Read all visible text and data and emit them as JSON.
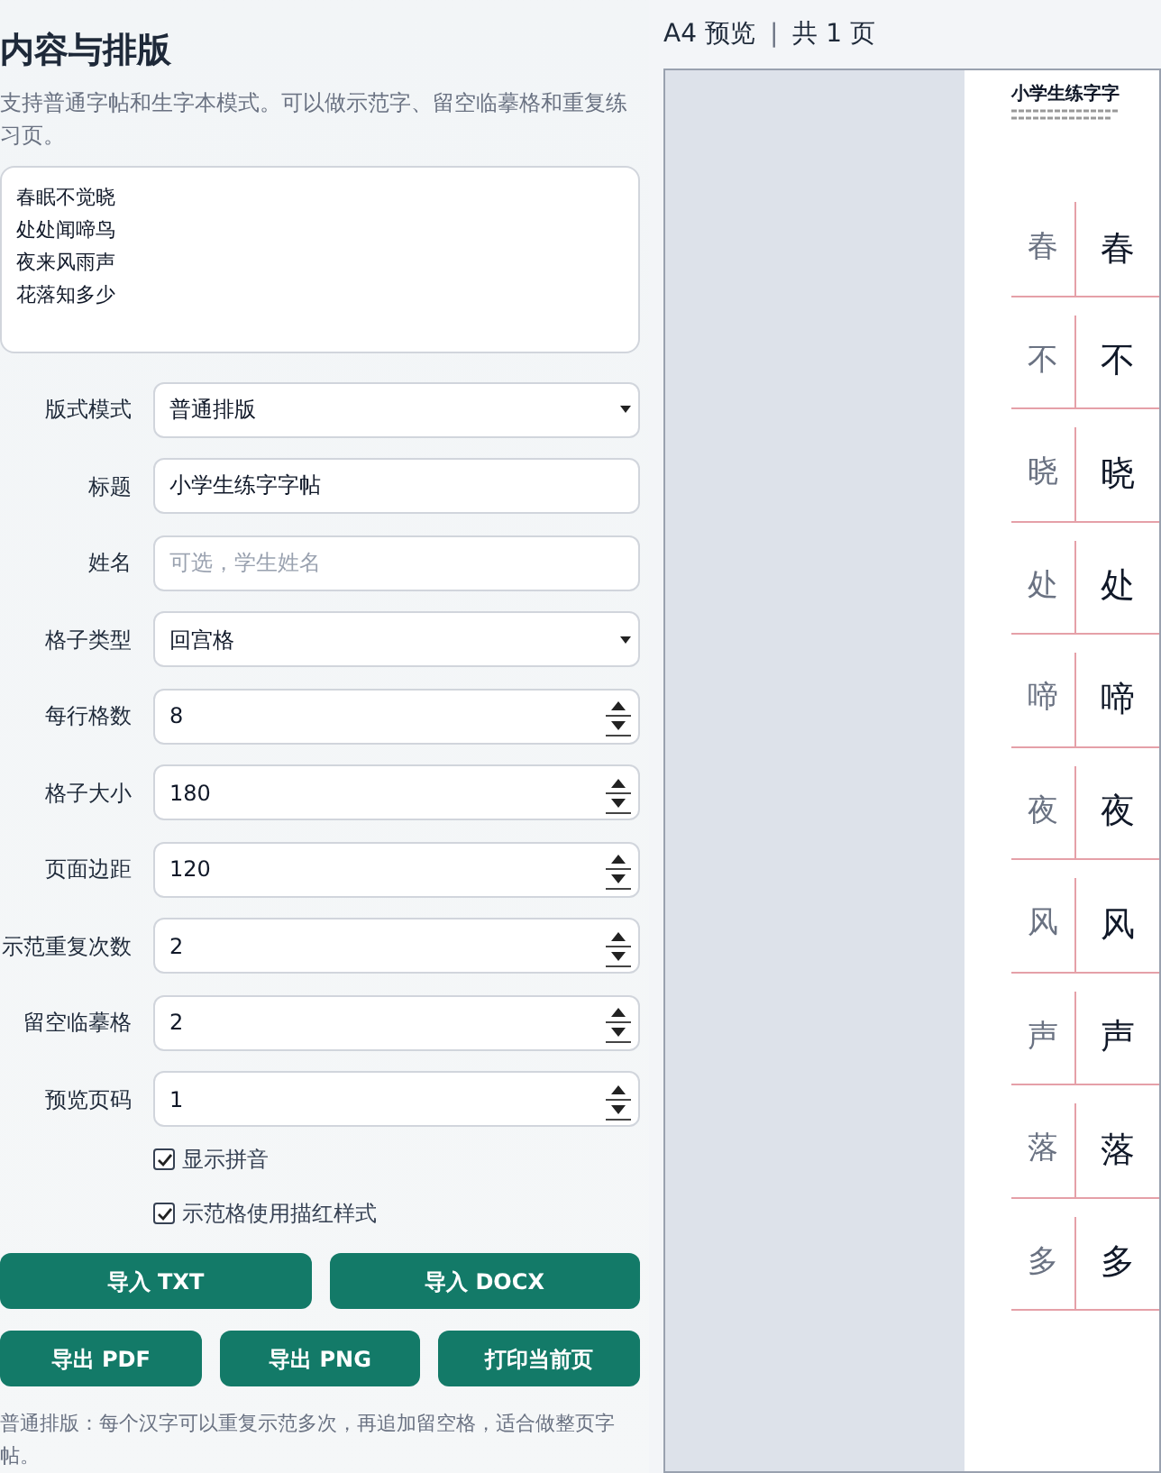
{
  "panel": {
    "title": "内容与排版",
    "description": "支持普通字帖和生字本模式。可以做示范字、留空临摹格和重复练习页。",
    "content_lines": [
      "春眠不觉晓",
      "处处闻啼鸟",
      "夜来风雨声",
      "花落知多少"
    ]
  },
  "fields": [
    {
      "kind": "select",
      "label": "版式模式",
      "value": "普通排版"
    },
    {
      "kind": "text",
      "label": "标题",
      "value": "小学生练字字帖"
    },
    {
      "kind": "text",
      "label": "姓名",
      "placeholder": "可选，学生姓名"
    },
    {
      "kind": "select",
      "label": "格子类型",
      "value": "回宫格"
    },
    {
      "kind": "number",
      "label": "每行格数",
      "value": "8"
    },
    {
      "kind": "number",
      "label": "格子大小",
      "value": "180"
    },
    {
      "kind": "number",
      "label": "页面边距",
      "value": "120"
    },
    {
      "kind": "number",
      "label": "示范重复次数",
      "value": "2"
    },
    {
      "kind": "number",
      "label": "留空临摹格",
      "value": "2"
    },
    {
      "kind": "number",
      "label": "预览页码",
      "value": "1"
    }
  ],
  "checkboxes": [
    {
      "label": "显示拼音",
      "checked": true
    },
    {
      "label": "示范格使用描红样式",
      "checked": true
    }
  ],
  "button_rows": [
    [
      "导入 TXT",
      "导入 DOCX"
    ],
    [
      "导出 PDF",
      "导出 PNG",
      "打印当前页"
    ]
  ],
  "note": "普通排版：每个汉字可以重复示范多次，再追加留空格，适合做整页字帖。",
  "preview": {
    "size": "A4 预览",
    "separator": "|",
    "pages": "共 1 页",
    "page_title": "小学生练字字",
    "rows": [
      {
        "trace": "春",
        "char": "春"
      },
      {
        "trace": "不",
        "char": "不"
      },
      {
        "trace": "晓",
        "char": "晓"
      },
      {
        "trace": "处",
        "char": "处"
      },
      {
        "trace": "啼",
        "char": "啼"
      },
      {
        "trace": "夜",
        "char": "夜"
      },
      {
        "trace": "风",
        "char": "风"
      },
      {
        "trace": "声",
        "char": "声"
      },
      {
        "trace": "落",
        "char": "落"
      },
      {
        "trace": "多",
        "char": "多"
      }
    ]
  }
}
